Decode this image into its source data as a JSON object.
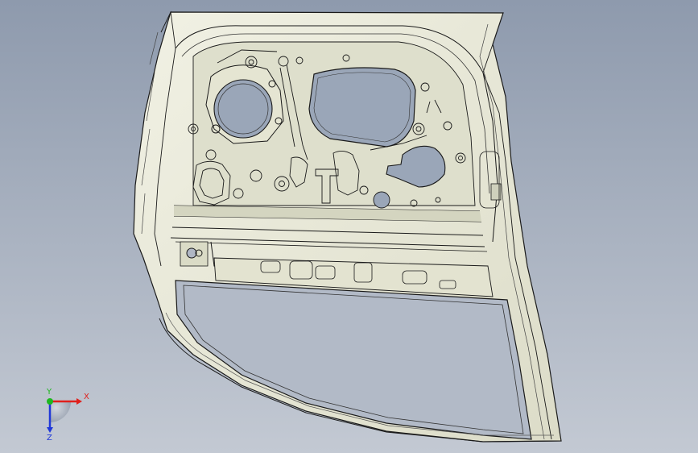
{
  "viewport": {
    "model_description": "",
    "colors": {
      "background_top": "#8e9aad",
      "background_bottom": "#c3c9d3",
      "panel_fill": "#ebebdc",
      "panel_shade": "#d9dac6",
      "edge_line": "#1a1a1a",
      "hole_fill": "#9aa6b8"
    }
  },
  "triad": {
    "x_label": "X",
    "y_label": "Y",
    "z_label": "Z",
    "colors": {
      "x": "#e0201c",
      "y": "#1fb81f",
      "z": "#2038d8"
    }
  }
}
